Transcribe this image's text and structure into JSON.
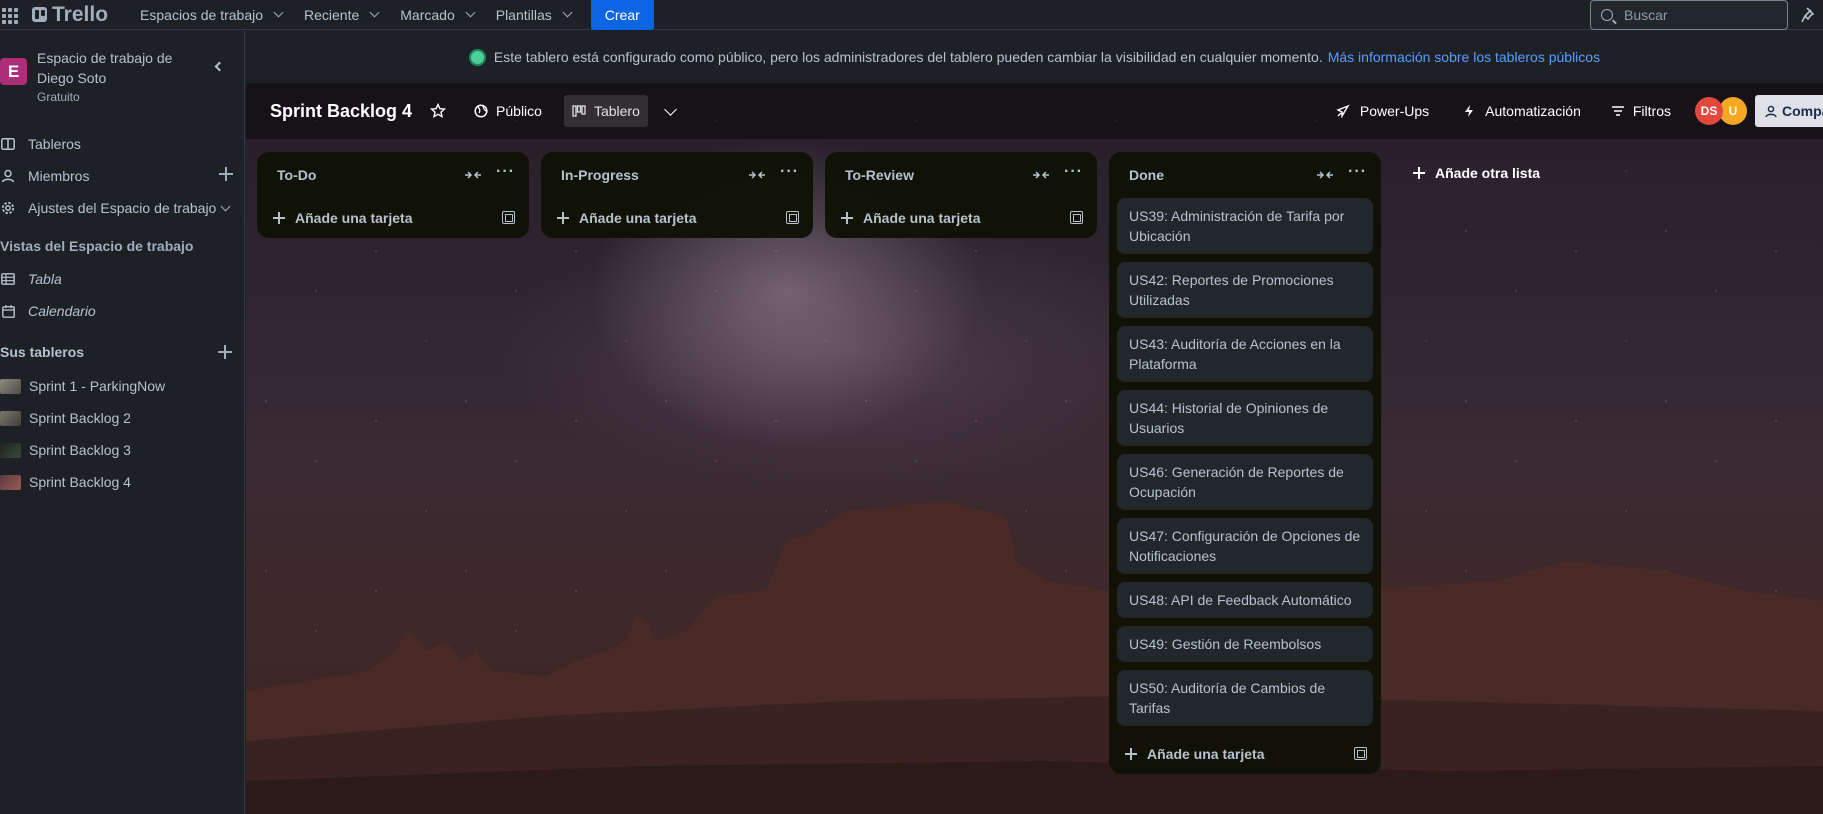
{
  "topbar": {
    "app_name": "Trello",
    "nav": [
      {
        "label": "Espacios de trabajo"
      },
      {
        "label": "Reciente"
      },
      {
        "label": "Marcado"
      },
      {
        "label": "Plantillas"
      }
    ],
    "create_label": "Crear",
    "search_placeholder": "Buscar"
  },
  "sidebar": {
    "workspace_initial": "E",
    "workspace_name": "Espacio de trabajo de Diego Soto",
    "workspace_plan": "Gratuito",
    "items": [
      {
        "label": "Tableros"
      },
      {
        "label": "Miembros"
      },
      {
        "label": "Ajustes del Espacio de trabajo"
      }
    ],
    "views_title": "Vistas del Espacio de trabajo",
    "views": [
      {
        "label": "Tabla"
      },
      {
        "label": "Calendario"
      }
    ],
    "boards_title": "Sus tableros",
    "boards": [
      {
        "label": "Sprint 1 - ParkingNow"
      },
      {
        "label": "Sprint Backlog 2"
      },
      {
        "label": "Sprint Backlog 3"
      },
      {
        "label": "Sprint Backlog 4"
      }
    ]
  },
  "notice": {
    "text": "Este tablero está configurado como público, pero los administradores del tablero pueden cambiar la visibilidad en cualquier momento.",
    "link": "Más información sobre los tableros públicos"
  },
  "board": {
    "title": "Sprint Backlog 4",
    "visibility": "Público",
    "view": "Tablero",
    "powerups": "Power-Ups",
    "automation": "Automatización",
    "filters": "Filtros",
    "avatars": [
      {
        "initials": "DS",
        "color": "#e2483d"
      },
      {
        "initials": "U",
        "color": "#f5a623"
      }
    ],
    "share": "Compartir"
  },
  "lists": [
    {
      "title": "To-Do",
      "cards": [],
      "add_label": "Añade una tarjeta"
    },
    {
      "title": "In-Progress",
      "cards": [],
      "add_label": "Añade una tarjeta"
    },
    {
      "title": "To-Review",
      "cards": [],
      "add_label": "Añade una tarjeta"
    },
    {
      "title": "Done",
      "cards": [
        "US39: Administración de Tarifa por Ubicación",
        "US42: Reportes de Promociones Utilizadas",
        "US43: Auditoría de Acciones en la Plataforma",
        "US44: Historial de Opiniones de Usuarios",
        "US46: Generación de Reportes de Ocupación",
        "US47: Configuración de Opciones de Notificaciones",
        "US48: API de Feedback Automático",
        "US49: Gestión de Reembolsos",
        "US50: Auditoría de Cambios de Tarifas"
      ],
      "add_label": "Añade una tarjeta"
    }
  ],
  "add_list_label": "Añade otra lista"
}
